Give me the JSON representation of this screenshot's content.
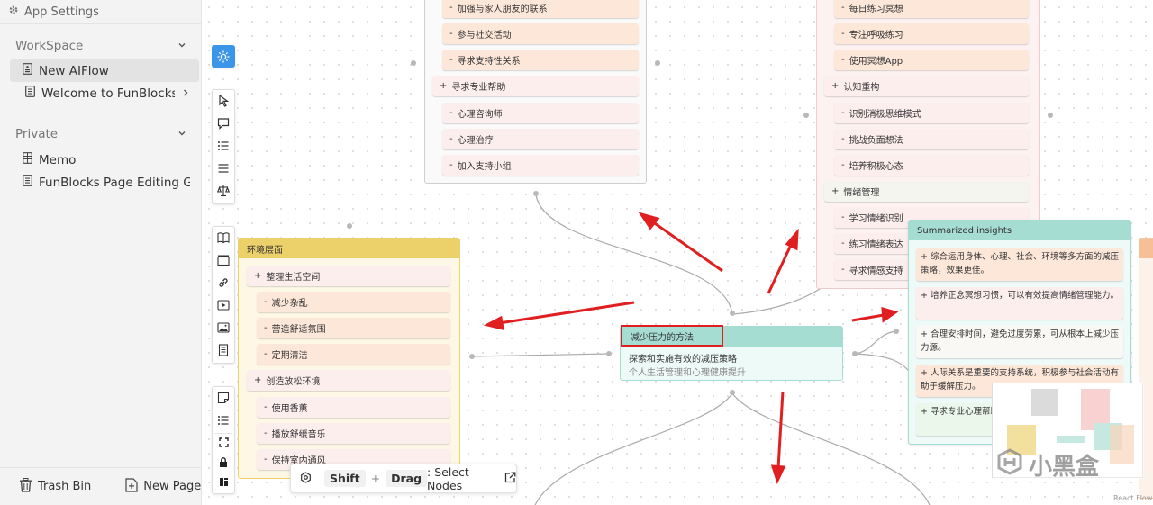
{
  "sidebar": {
    "settings_label": "App Settings",
    "workspace_label": "WorkSpace",
    "workspace_items": [
      {
        "label": "New AIFlow"
      },
      {
        "label": "Welcome to FunBlocks!"
      }
    ],
    "private_label": "Private",
    "private_items": [
      {
        "label": "Memo"
      },
      {
        "label": "FunBlocks Page Editing Guide"
      }
    ],
    "trash_label": "Trash Bin",
    "new_page_label": "New Page"
  },
  "top_left_card": {
    "items": [
      {
        "label": "加强与家人朋友的联系",
        "type": "sub"
      },
      {
        "label": "参与社交活动",
        "type": "sub"
      },
      {
        "label": "寻求支持性关系",
        "type": "sub"
      },
      {
        "label": "寻求专业帮助",
        "type": "group"
      },
      {
        "label": "心理咨询师",
        "type": "sub"
      },
      {
        "label": "心理治疗",
        "type": "sub"
      },
      {
        "label": "加入支持小组",
        "type": "sub"
      }
    ]
  },
  "top_right_card": {
    "items": [
      {
        "label": "每日练习冥想",
        "type": "sub"
      },
      {
        "label": "专注呼吸练习",
        "type": "sub"
      },
      {
        "label": "使用冥想App",
        "type": "sub"
      },
      {
        "label": "认知重构",
        "type": "group"
      },
      {
        "label": "识别消极思维模式",
        "type": "sub"
      },
      {
        "label": "挑战负面想法",
        "type": "sub"
      },
      {
        "label": "培养积极心态",
        "type": "sub"
      },
      {
        "label": "情绪管理",
        "type": "group"
      },
      {
        "label": "学习情绪识别",
        "type": "sub"
      },
      {
        "label": "练习情绪表达",
        "type": "sub"
      },
      {
        "label": "寻求情感支持",
        "type": "sub"
      }
    ]
  },
  "env_card": {
    "title": "环境层面",
    "items": [
      {
        "label": "整理生活空间",
        "type": "group"
      },
      {
        "label": "减少杂乱",
        "type": "sub"
      },
      {
        "label": "营造舒适氛围",
        "type": "sub"
      },
      {
        "label": "定期清洁",
        "type": "sub"
      },
      {
        "label": "创造放松环境",
        "type": "group"
      },
      {
        "label": "使用香薰",
        "type": "sub"
      },
      {
        "label": "播放舒缓音乐",
        "type": "sub"
      },
      {
        "label": "保持室内通风",
        "type": "sub"
      }
    ]
  },
  "center_card": {
    "title": "减少压力的方法",
    "subtitle": "探索和实施有效的减压策略",
    "description": "个人生活管理和心理健康提升"
  },
  "insights_card": {
    "title": "Summarized insights",
    "items": [
      "+ 综合运用身体、心理、社会、环境等多方面的减压策略，效果更佳。",
      "+ 培养正念冥想习惯，可以有效提高情绪管理能力。",
      "+ 合理安排时间，避免过度劳累，可从根本上减少压力源。",
      "+ 人际关系是重要的支持系统，积极参与社会活动有助于缓解压力。",
      "+ 寻求专业心理帮助径。"
    ]
  },
  "hint_bar": {
    "key1": "Shift",
    "plus": "+",
    "key2": "Drag",
    "text": ": Select Nodes"
  },
  "watermark": {
    "text": "小黑盒",
    "attribution": "React Flow"
  },
  "colors": {
    "accent_blue": "#3b95e8",
    "arrow_red": "#e02020",
    "env_header": "#ecd06a",
    "center_header": "#a6ddd2",
    "peach_node": "#fde7d9",
    "pink_node": "#fdeeee"
  }
}
